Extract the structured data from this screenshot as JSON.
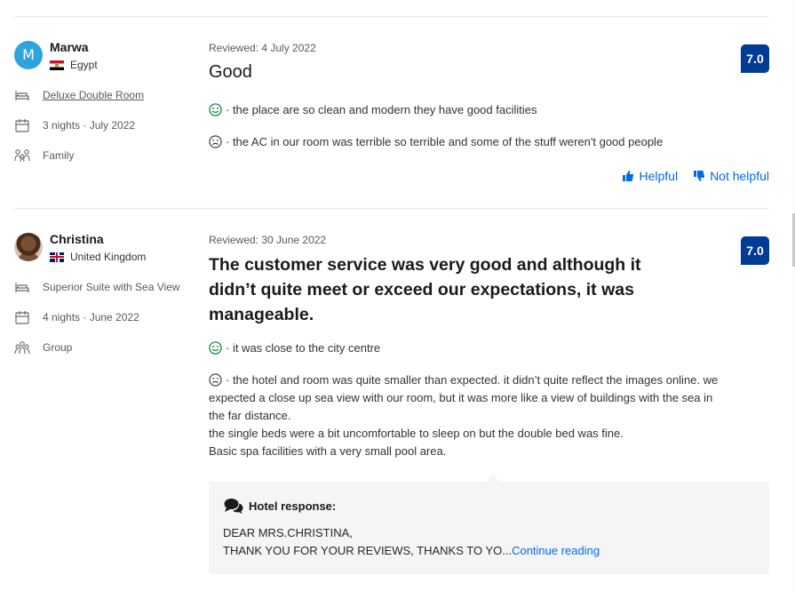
{
  "colors": {
    "score_bg": "#003b95",
    "link": "#006ce4",
    "positive": "#008234",
    "avatar_bg": "#2da4e0"
  },
  "reviews": [
    {
      "avatar_letter": "M",
      "name": "Marwa",
      "country": "Egypt",
      "room": "Deluxe Double Room",
      "stay": "3 nights · July 2022",
      "traveler_type": "Family",
      "reviewed_date": "Reviewed: 4 July 2022",
      "title": "Good",
      "score": "7.0",
      "positive": "· the place are so clean and modern they have good facilities",
      "negative": "· the AC in our room was terrible so terrible and some of the stuff weren't good people",
      "helpful_label": "Helpful",
      "not_helpful_label": "Not helpful"
    },
    {
      "name": "Christina",
      "country": "United Kingdom",
      "room": "Superior Suite with Sea View",
      "stay": "4 nights · June 2022",
      "traveler_type": "Group",
      "reviewed_date": "Reviewed: 30 June 2022",
      "title": "The customer service was very good and although it didn’t quite meet or exceed our expectations, it was manageable.",
      "score": "7.0",
      "positive": "· it was close to the city centre",
      "negative_lines": [
        "· the hotel and room was quite smaller than expected. it didn’t quite reflect the images online. we",
        "expected a close up sea view with our room, but it was more like a view of buildings with the sea in",
        "the far distance.",
        "the single beds were a bit uncomfortable to sleep on but the double bed was fine.",
        "Basic spa facilities with a very small pool area."
      ],
      "response": {
        "header": "Hotel response:",
        "line1": "DEAR MRS.CHRISTINA,",
        "line2": "THANK YOU FOR YOUR REVIEWS, THANKS TO YO...",
        "continue_label": "Continue reading"
      }
    }
  ]
}
